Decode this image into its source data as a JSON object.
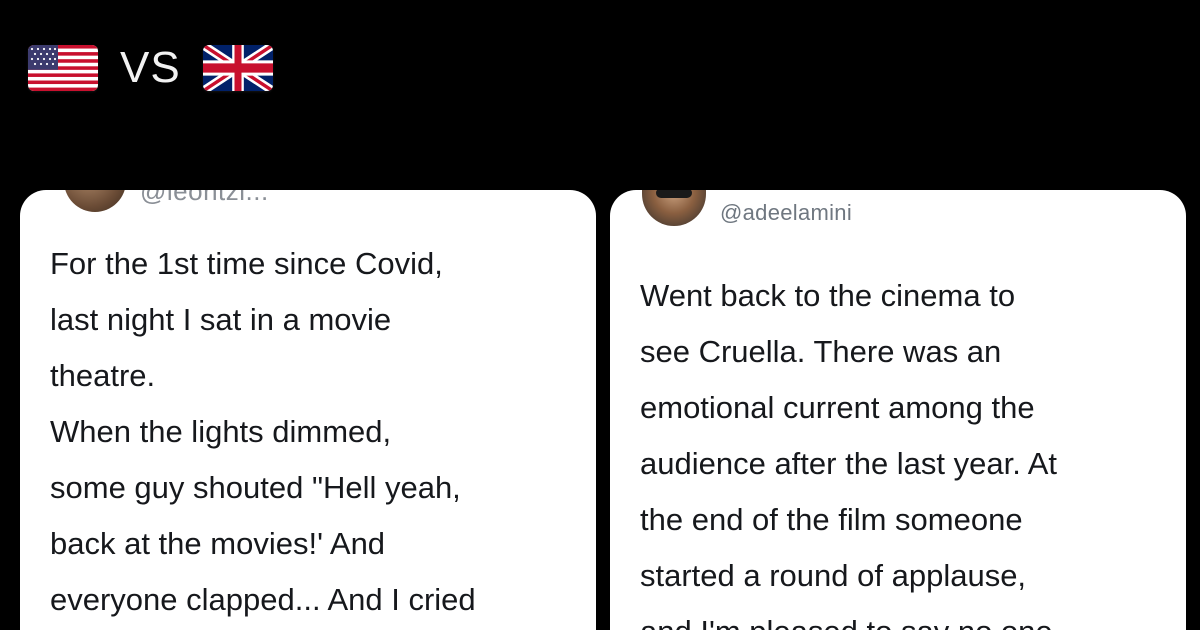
{
  "header": {
    "left_flag_icon": "us-flag-icon",
    "vs_label": "VS",
    "right_flag_icon": "uk-flag-icon"
  },
  "left_tweet": {
    "handle_partial": "@leontzi...",
    "text": "For the 1st time since Covid,\nlast night I sat in a movie\ntheatre.\nWhen the lights dimmed,\nsome guy shouted \"Hell yeah,\nback at the movies!' And\neveryone clapped... And I cried"
  },
  "right_tweet": {
    "handle": "@adeelamini",
    "text": "Went back to the cinema to\nsee Cruella. There was an\nemotional current among the\naudience after the last year. At\nthe end of the film someone\nstarted a round of applause,\nand I'm pleased to say no one"
  },
  "colors": {
    "background": "#000000",
    "card": "#ffffff",
    "text": "#16181c",
    "handle": "#6f7780"
  }
}
